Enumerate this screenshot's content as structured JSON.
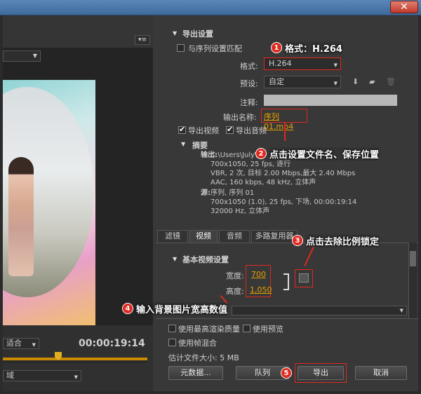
{
  "window": {
    "close_icon": "✕"
  },
  "left": {
    "menu_icon": "▾≡",
    "zoom": "",
    "fit": "适合",
    "timecode": "00:00:19:14",
    "source": "域"
  },
  "export": {
    "section_title": "导出设置",
    "match_sequence": "与序列设置匹配",
    "format_label": "格式:",
    "format_value": "H.264",
    "preset_label": "预设:",
    "preset_value": "自定",
    "notes_label": "注释:",
    "output_name_label": "输出名称:",
    "output_name_value": "序列 01.mp4",
    "export_video": "导出视频",
    "export_audio": "导出音频",
    "summary_title": "摘要",
    "output_label": "输出:",
    "output_lines": [
      "C:\\Users\\July\\",
      "700x1050, 25 fps, 逐行",
      "VBR, 2 次, 目标 2.00 Mbps,最大 2.40 Mbps",
      "AAC, 160 kbps, 48 kHz, 立体声"
    ],
    "source_label": "源:",
    "source_lines": [
      "序列, 序列 01",
      "700x1050 (1.0), 25 fps, 下场, 00:00:19:14",
      "32000 Hz, 立体声"
    ]
  },
  "tabs": [
    "滤镜",
    "视频",
    "音频",
    "多路复用器"
  ],
  "video": {
    "section_title": "基本视频设置",
    "width_label": "宽度:",
    "width_value": "700",
    "height_label": "高度:",
    "height_value": "1,050"
  },
  "bottom": {
    "max_render": "使用最高渲染质量",
    "use_preview": "使用预览",
    "frame_blend": "使用帧混合",
    "est_size": "估计文件大小: 5 MB",
    "metadata": "元数据...",
    "queue": "队列",
    "export": "导出",
    "cancel": "取消"
  },
  "annotations": [
    {
      "n": "1",
      "text": "格式：H.264"
    },
    {
      "n": "2",
      "text": "点击设置文件名、保存位置"
    },
    {
      "n": "3",
      "text": "点击去除比例锁定"
    },
    {
      "n": "4",
      "text": "输入背景图片宽高数值"
    },
    {
      "n": "5",
      "text": ""
    }
  ]
}
